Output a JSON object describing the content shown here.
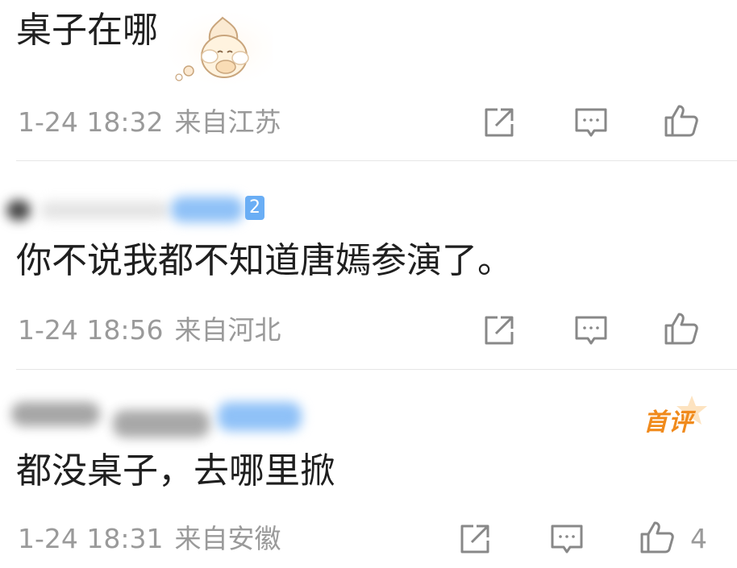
{
  "comments": [
    {
      "text": "桌子在哪",
      "date": "1-24 18:32",
      "location": "来自江苏",
      "like_count": ""
    },
    {
      "username_badge": "2",
      "text": "你不说我都不知道唐嫣参演了。",
      "date": "1-24 18:56",
      "location": "来自河北",
      "like_count": ""
    },
    {
      "top_badge": "首评",
      "text": "都没桌子，去哪里掀",
      "date": "1-24 18:31",
      "location": "来自安徽",
      "like_count": "4"
    }
  ],
  "colors": {
    "icon_gray": "#888888",
    "meta_gray": "#9a9a9a",
    "badge_blue": "#6aaef5",
    "top_badge_orange": "#f08a1c"
  },
  "icons": [
    "share-icon",
    "comment-icon",
    "like-icon",
    "sticker-emoji"
  ]
}
